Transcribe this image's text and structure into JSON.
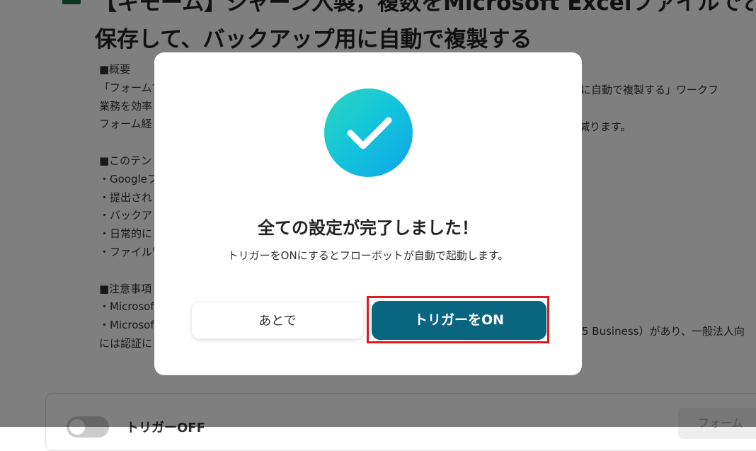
{
  "background": {
    "title_line1": "【キモーム】ジャーン入製，複数をMicrosoft Excelファイルでと",
    "title_line2": "保存して、バックアップ用に自動で複製する",
    "description_lines": [
      "■概要",
      "「フォームで",
      "業務を効率",
      "フォーム経",
      "",
      "■このテン",
      "・Googleフ",
      "・提出され",
      "・バックアッ",
      "・日常的に",
      "・ファイル管",
      "",
      "■注意事項",
      "・Microsof",
      "・Microsof",
      "には認証に"
    ],
    "right_fragments": {
      "line1": "プ用に自動で複製する」ワークフ",
      "line3": "減ります。",
      "line15": "5 Business）があり、一般法人向"
    },
    "trigger_off_label": "トリガーOFF",
    "bottom_button_label": "フォーム"
  },
  "modal": {
    "icon": "check-icon",
    "title": "全ての設定が完了しました！",
    "subtitle": "トリガーをONにするとフローボットが自動で起動します。",
    "later_button": "あとで",
    "on_button": "トリガーをON"
  },
  "colors": {
    "overlay": "rgba(0,0,0,0.5)",
    "on_button": "#0a6580",
    "highlight": "#e0191e",
    "check_gradient_start": "#2dd4bf",
    "check_gradient_end": "#0ea5e9"
  }
}
